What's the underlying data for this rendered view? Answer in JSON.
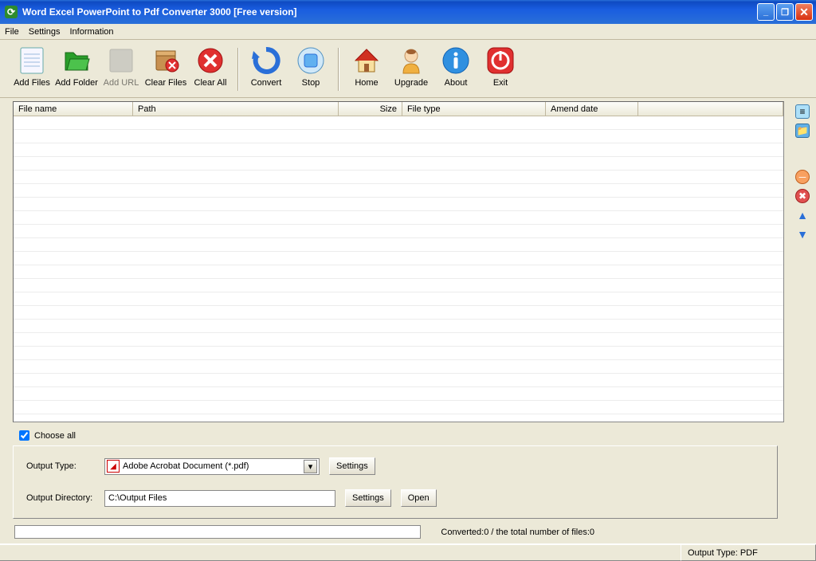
{
  "titlebar": {
    "title": "Word Excel PowerPoint to Pdf Converter 3000 [Free version]"
  },
  "menu": {
    "file": "File",
    "settings": "Settings",
    "info": "Information"
  },
  "toolbar": {
    "add_files": "Add Files",
    "add_folder": "Add Folder",
    "add_url": "Add URL",
    "clear_files": "Clear Files",
    "clear_all": "Clear All",
    "convert": "Convert",
    "stop": "Stop",
    "home": "Home",
    "upgrade": "Upgrade",
    "about": "About",
    "exit": "Exit"
  },
  "columns": {
    "file_name": "File name",
    "path": "Path",
    "size": "Size",
    "file_type": "File type",
    "amend_date": "Amend date"
  },
  "choose_all": "Choose all",
  "output": {
    "type_label": "Output Type:",
    "type_value": "Adobe Acrobat Document (*.pdf)",
    "dir_label": "Output Directory:",
    "dir_value": "C:\\Output Files",
    "settings_btn": "Settings",
    "open_btn": "Open"
  },
  "progress": {
    "text": "Converted:0  /  the total number of files:0"
  },
  "status": {
    "output_type": "Output Type: PDF"
  }
}
